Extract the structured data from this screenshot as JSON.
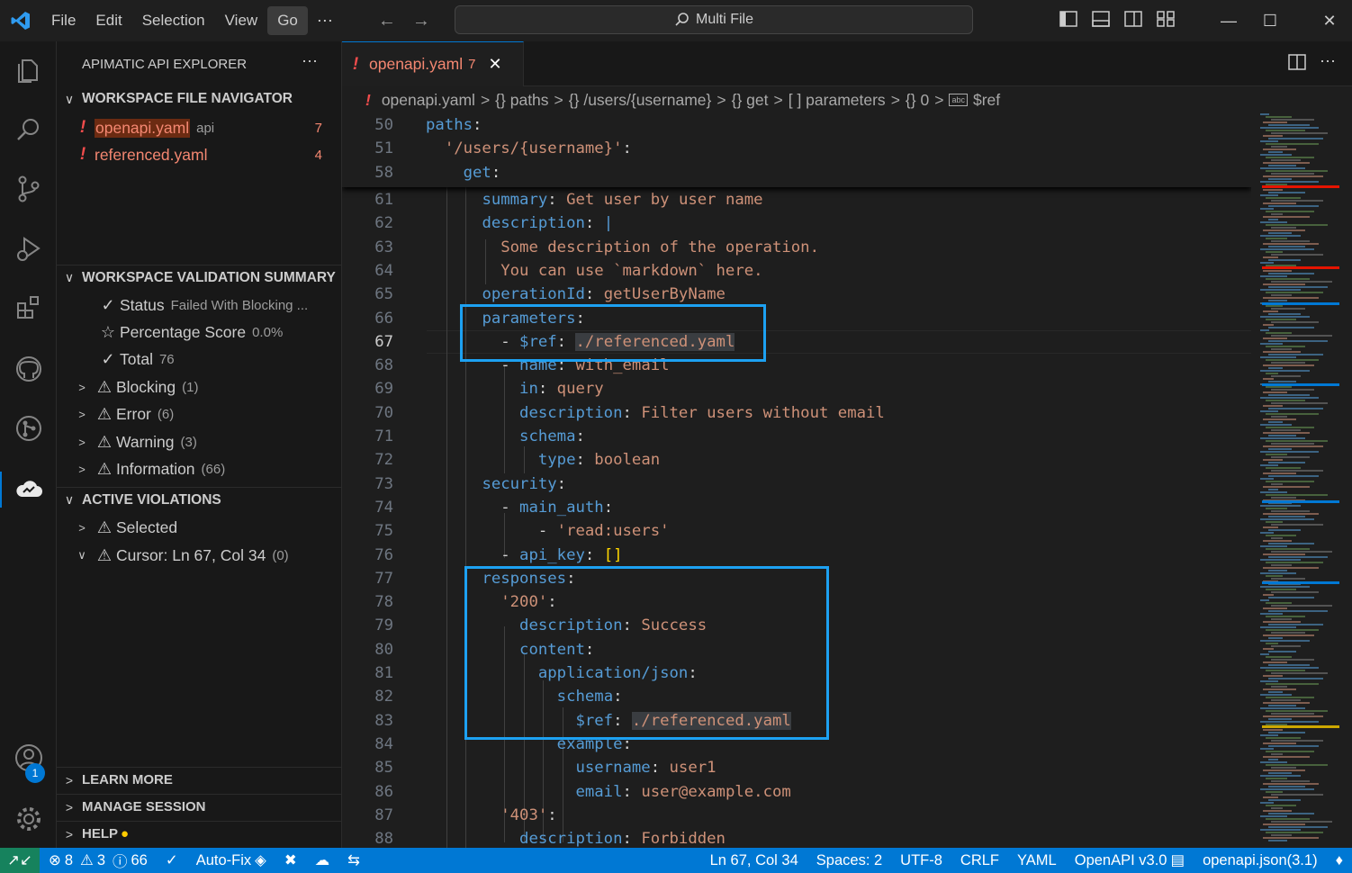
{
  "menu": {
    "items": [
      "File",
      "Edit",
      "Selection",
      "View",
      "Go"
    ],
    "active": "Go",
    "more": "⋯"
  },
  "search": {
    "text": "Multi File"
  },
  "activity": {
    "accounts_badge": "1"
  },
  "sidebar": {
    "title": "APIMATIC API EXPLORER",
    "more": "⋯",
    "file_nav": {
      "header": "WORKSPACE FILE NAVIGATOR",
      "files": [
        {
          "icon": "!",
          "name": "openapi.yaml",
          "tag": "api",
          "count": "7"
        },
        {
          "icon": "!",
          "name": "referenced.yaml",
          "tag": "",
          "count": "4"
        }
      ]
    },
    "validation": {
      "header": "WORKSPACE VALIDATION SUMMARY",
      "status_label": "Status",
      "status_value": "Failed With Blocking ...",
      "score_label": "Percentage Score",
      "score_value": "0.0%",
      "total_label": "Total",
      "total_value": "76",
      "groups": [
        {
          "label": "Blocking",
          "count": "(1)"
        },
        {
          "label": "Error",
          "count": "(6)"
        },
        {
          "label": "Warning",
          "count": "(3)"
        },
        {
          "label": "Information",
          "count": "(66)"
        }
      ]
    },
    "violations": {
      "header": "ACTIVE VIOLATIONS",
      "selected": "Selected",
      "cursor_label": "Cursor: Ln 67, Col 34",
      "cursor_count": "(0)"
    },
    "bottom": {
      "learn": "LEARN MORE",
      "session": "MANAGE SESSION",
      "help": "HELP"
    }
  },
  "tab": {
    "title": "openapi.yaml",
    "count": "7"
  },
  "breadcrumb": {
    "file": "openapi.yaml",
    "parts": [
      "{} paths",
      "{} /users/{username}",
      "{} get",
      "[ ] parameters",
      "{} 0"
    ],
    "last": "$ref"
  },
  "editor": {
    "sticky": [
      {
        "n": "50",
        "t": [
          [
            "k",
            "paths"
          ],
          [
            "p",
            ":"
          ]
        ]
      },
      {
        "n": "51",
        "t": [
          [
            "p",
            "  "
          ],
          [
            "s",
            "'/users/{username}'"
          ],
          [
            "p",
            ":"
          ]
        ]
      },
      {
        "n": "58",
        "t": [
          [
            "p",
            "    "
          ],
          [
            "k",
            "get"
          ],
          [
            "p",
            ":"
          ]
        ]
      }
    ],
    "lines": [
      {
        "n": "61",
        "t": [
          [
            "p",
            "      "
          ],
          [
            "k",
            "summary"
          ],
          [
            "p",
            ": "
          ],
          [
            "s",
            "Get user by user name"
          ]
        ]
      },
      {
        "n": "62",
        "t": [
          [
            "p",
            "      "
          ],
          [
            "k",
            "description"
          ],
          [
            "p",
            ": "
          ],
          [
            "k",
            "|"
          ]
        ]
      },
      {
        "n": "63",
        "t": [
          [
            "p",
            "        "
          ],
          [
            "s",
            "Some description of the operation."
          ]
        ]
      },
      {
        "n": "64",
        "t": [
          [
            "p",
            "        "
          ],
          [
            "s",
            "You can use `markdown` here."
          ]
        ]
      },
      {
        "n": "65",
        "t": [
          [
            "p",
            "      "
          ],
          [
            "k",
            "operationId"
          ],
          [
            "p",
            ": "
          ],
          [
            "s",
            "getUserByName"
          ]
        ]
      },
      {
        "n": "66",
        "t": [
          [
            "p",
            "      "
          ],
          [
            "k",
            "parameters"
          ],
          [
            "p",
            ":"
          ]
        ]
      },
      {
        "n": "67",
        "t": [
          [
            "p",
            "        - "
          ],
          [
            "k",
            "$ref"
          ],
          [
            "p",
            ": "
          ],
          [
            "hl",
            "./referenced.yaml"
          ]
        ]
      },
      {
        "n": "68",
        "t": [
          [
            "p",
            "        - "
          ],
          [
            "k",
            "name"
          ],
          [
            "p",
            ": "
          ],
          [
            "s",
            "with_email"
          ]
        ]
      },
      {
        "n": "69",
        "t": [
          [
            "p",
            "          "
          ],
          [
            "k",
            "in"
          ],
          [
            "p",
            ": "
          ],
          [
            "s",
            "query"
          ]
        ]
      },
      {
        "n": "70",
        "t": [
          [
            "p",
            "          "
          ],
          [
            "k",
            "description"
          ],
          [
            "p",
            ": "
          ],
          [
            "s",
            "Filter users without email"
          ]
        ]
      },
      {
        "n": "71",
        "t": [
          [
            "p",
            "          "
          ],
          [
            "k",
            "schema"
          ],
          [
            "p",
            ":"
          ]
        ]
      },
      {
        "n": "72",
        "t": [
          [
            "p",
            "            "
          ],
          [
            "k",
            "type"
          ],
          [
            "p",
            ": "
          ],
          [
            "s",
            "boolean"
          ]
        ]
      },
      {
        "n": "73",
        "t": [
          [
            "p",
            "      "
          ],
          [
            "k",
            "security"
          ],
          [
            "p",
            ":"
          ]
        ]
      },
      {
        "n": "74",
        "t": [
          [
            "p",
            "        - "
          ],
          [
            "k",
            "main_auth"
          ],
          [
            "p",
            ":"
          ]
        ]
      },
      {
        "n": "75",
        "t": [
          [
            "p",
            "            - "
          ],
          [
            "s",
            "'read:users'"
          ]
        ]
      },
      {
        "n": "76",
        "t": [
          [
            "p",
            "        - "
          ],
          [
            "k",
            "api_key"
          ],
          [
            "p",
            ": "
          ],
          [
            "y",
            "[]"
          ]
        ]
      },
      {
        "n": "77",
        "t": [
          [
            "p",
            "      "
          ],
          [
            "k",
            "responses"
          ],
          [
            "p",
            ":"
          ]
        ]
      },
      {
        "n": "78",
        "t": [
          [
            "p",
            "        "
          ],
          [
            "s",
            "'200'"
          ],
          [
            "p",
            ":"
          ]
        ]
      },
      {
        "n": "79",
        "t": [
          [
            "p",
            "          "
          ],
          [
            "k",
            "description"
          ],
          [
            "p",
            ": "
          ],
          [
            "s",
            "Success"
          ]
        ]
      },
      {
        "n": "80",
        "t": [
          [
            "p",
            "          "
          ],
          [
            "k",
            "content"
          ],
          [
            "p",
            ":"
          ]
        ]
      },
      {
        "n": "81",
        "t": [
          [
            "p",
            "            "
          ],
          [
            "k",
            "application/json"
          ],
          [
            "p",
            ":"
          ]
        ]
      },
      {
        "n": "82",
        "t": [
          [
            "p",
            "              "
          ],
          [
            "k",
            "schema"
          ],
          [
            "p",
            ":"
          ]
        ]
      },
      {
        "n": "83",
        "t": [
          [
            "p",
            "                "
          ],
          [
            "k",
            "$ref"
          ],
          [
            "p",
            ": "
          ],
          [
            "hl",
            "./referenced.yaml"
          ]
        ]
      },
      {
        "n": "84",
        "t": [
          [
            "p",
            "              "
          ],
          [
            "k",
            "example"
          ],
          [
            "p",
            ":"
          ]
        ]
      },
      {
        "n": "85",
        "t": [
          [
            "p",
            "                "
          ],
          [
            "k",
            "username"
          ],
          [
            "p",
            ": "
          ],
          [
            "s",
            "user1"
          ]
        ]
      },
      {
        "n": "86",
        "t": [
          [
            "p",
            "                "
          ],
          [
            "k",
            "email"
          ],
          [
            "p",
            ": "
          ],
          [
            "s",
            "user@example.com"
          ]
        ]
      },
      {
        "n": "87",
        "t": [
          [
            "p",
            "        "
          ],
          [
            "s",
            "'403'"
          ],
          [
            "p",
            ":"
          ]
        ]
      },
      {
        "n": "88",
        "t": [
          [
            "p",
            "          "
          ],
          [
            "k",
            "description"
          ],
          [
            "p",
            ": "
          ],
          [
            "s",
            "Forbidden"
          ]
        ]
      }
    ],
    "current_line": "67"
  },
  "status": {
    "errors": "8",
    "warnings": "3",
    "infos": "66",
    "autofix": "Auto-Fix",
    "position": "Ln 67, Col 34",
    "spaces": "Spaces: 2",
    "encoding": "UTF-8",
    "eol": "CRLF",
    "language": "YAML",
    "spec": "OpenAPI v3.0",
    "schema": "openapi.json(3.1)"
  },
  "colors": {
    "accent": "#0078d4",
    "error": "#f48771",
    "highlight_box": "#1da1f2",
    "remote": "#16825d"
  }
}
